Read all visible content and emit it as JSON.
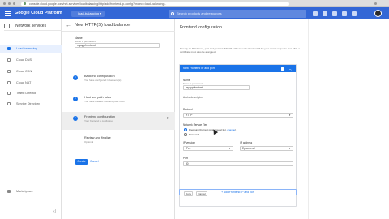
{
  "browser": {
    "url": "console.cloud.google.com/net-services/loadbalancing/http/add/frontend-ip-config?project=load-balancing..."
  },
  "header": {
    "brand": "Google Cloud Platform",
    "project": "load-balancing ▾",
    "search_placeholder": "Search products and resources"
  },
  "nav": {
    "title": "Network services",
    "items": [
      {
        "label": "Load balancing",
        "active": true
      },
      {
        "label": "Cloud DNS"
      },
      {
        "label": "Cloud CDN"
      },
      {
        "label": "Cloud NAT"
      },
      {
        "label": "Traffic Director"
      },
      {
        "label": "Service Directory"
      }
    ],
    "marketplace": "Marketplace",
    "collapse": "‹|"
  },
  "middle": {
    "title": "New HTTP(S) load balancer",
    "name_label": "Name",
    "name_hint": "Name is permanent",
    "name_value": "myappfrontend",
    "steps": [
      {
        "title": "Backend configuration",
        "desc": "You have configured 1 backend(s)"
      },
      {
        "title": "Host and path rules",
        "desc": "You have created host and path rules"
      },
      {
        "title": "Frontend configuration",
        "desc": "Your frontend is configured"
      },
      {
        "title": "Review and finalize",
        "desc": "Optional"
      }
    ],
    "create_label": "Create",
    "cancel_label": "Cancel"
  },
  "panel": {
    "title": "Frontend configuration",
    "description": "Specify an IP address, port and protocol. This IP address is the frontend IP for your clients requests. For SSL, a certificate must also be assigned.",
    "card_title": "New Frontend IP and port",
    "name_label": "Name",
    "name_hint": "Name is permanent",
    "name_value": "myappfrontend",
    "add_description": "Add a description",
    "protocol_label": "Protocol",
    "protocol_value": "HTTP",
    "tier_label": "Network Service Tier",
    "tier_premium": "Premium (Current project-level tier,",
    "tier_change": "change",
    "tier_close": ")",
    "tier_standard": "Standard",
    "ipversion_label": "IP version",
    "ipversion_value": "IPv4",
    "ipaddress_label": "IP address",
    "ipaddress_value": "Ephemeral",
    "port_label": "Port",
    "port_value": "80",
    "done_label": "Done",
    "cancel_label": "Cancel",
    "add_button": "+ Add Frontend IP and port"
  },
  "colors": {
    "header_bg": "#3367d6",
    "accent": "#1a73e8",
    "nav_active_bg": "#e8f0fe"
  }
}
